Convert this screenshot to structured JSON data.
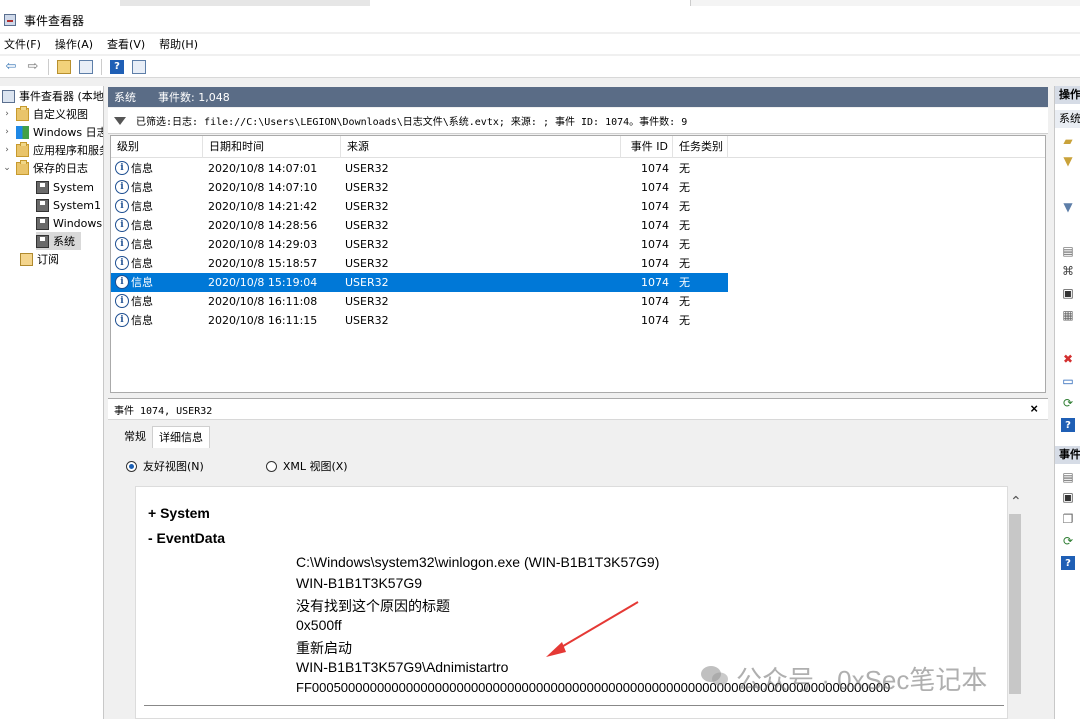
{
  "window": {
    "title": "事件查看器"
  },
  "menu": [
    "文件(F)",
    "操作(A)",
    "查看(V)",
    "帮助(H)"
  ],
  "tree": [
    {
      "label": "事件查看器 (本地)",
      "indent": 0,
      "icon": "viewer-icon",
      "expander": ""
    },
    {
      "label": "自定义视图",
      "indent": 1,
      "icon": "folder-icon",
      "expander": "›"
    },
    {
      "label": "Windows 日志",
      "indent": 1,
      "icon": "windows-logo-icon",
      "expander": "›"
    },
    {
      "label": "应用程序和服务日志",
      "indent": 1,
      "icon": "folder-icon",
      "expander": "›"
    },
    {
      "label": "保存的日志",
      "indent": 1,
      "icon": "folder-icon",
      "expander": "⌄"
    },
    {
      "label": "System",
      "indent": 2,
      "icon": "saved-log-icon",
      "expander": ""
    },
    {
      "label": "System1",
      "indent": 2,
      "icon": "saved-log-icon",
      "expander": ""
    },
    {
      "label": "Windows",
      "indent": 2,
      "icon": "saved-log-icon",
      "expander": ""
    },
    {
      "label": "系统",
      "indent": 2,
      "icon": "saved-log-icon",
      "expander": "",
      "selected": true
    },
    {
      "label": "订阅",
      "indent": 0,
      "icon": "subscription-icon",
      "expander": ""
    }
  ],
  "center": {
    "log_name": "系统",
    "event_count": "事件数: 1,048"
  },
  "filter": {
    "text": "已筛选:日志: file://C:\\Users\\LEGION\\Downloads\\日志文件\\系统.evtx; 来源: ; 事件 ID: 1074。事件数: 9"
  },
  "grid": {
    "columns": [
      "级别",
      "日期和时间",
      "来源",
      "事件 ID",
      "任务类别"
    ],
    "rows": [
      {
        "level": "信息",
        "datetime": "2020/10/8 14:07:01",
        "source": "USER32",
        "event_id": "1074",
        "task": "无"
      },
      {
        "level": "信息",
        "datetime": "2020/10/8 14:07:10",
        "source": "USER32",
        "event_id": "1074",
        "task": "无"
      },
      {
        "level": "信息",
        "datetime": "2020/10/8 14:21:42",
        "source": "USER32",
        "event_id": "1074",
        "task": "无"
      },
      {
        "level": "信息",
        "datetime": "2020/10/8 14:28:56",
        "source": "USER32",
        "event_id": "1074",
        "task": "无"
      },
      {
        "level": "信息",
        "datetime": "2020/10/8 14:29:03",
        "source": "USER32",
        "event_id": "1074",
        "task": "无"
      },
      {
        "level": "信息",
        "datetime": "2020/10/8 15:18:57",
        "source": "USER32",
        "event_id": "1074",
        "task": "无"
      },
      {
        "level": "信息",
        "datetime": "2020/10/8 15:19:04",
        "source": "USER32",
        "event_id": "1074",
        "task": "无",
        "selected": true
      },
      {
        "level": "信息",
        "datetime": "2020/10/8 16:11:08",
        "source": "USER32",
        "event_id": "1074",
        "task": "无"
      },
      {
        "level": "信息",
        "datetime": "2020/10/8 16:11:15",
        "source": "USER32",
        "event_id": "1074",
        "task": "无"
      }
    ]
  },
  "detail": {
    "title": "事件 1074, USER32",
    "tabs": [
      "常规",
      "详细信息"
    ],
    "active_tab": "详细信息",
    "views": [
      "友好视图(N)",
      "XML 视图(X)"
    ],
    "selected_view": "友好视图(N)",
    "sections": {
      "system": "+ System",
      "eventdata": "-  EventData"
    },
    "eventdata": [
      "C:\\Windows\\system32\\winlogon.exe (WIN-B1B1T3K57G9)",
      "WIN-B1B1T3K57G9",
      "没有找到这个原因的标题",
      "0x500ff",
      "重新启动",
      "WIN-B1B1T3K57G9\\Adnimistartro",
      "FF00050000000000000000000000000000000000000000000000000000000000000000000000000000"
    ]
  },
  "actions": {
    "header": "操作",
    "sub1": "系统",
    "sub2": "事件"
  },
  "watermark": "公众号 · 0xSec笔记本",
  "colors": {
    "selection": "#0078d7",
    "header_bar": "#5a6c86",
    "annotation_arrow": "#e53935"
  }
}
